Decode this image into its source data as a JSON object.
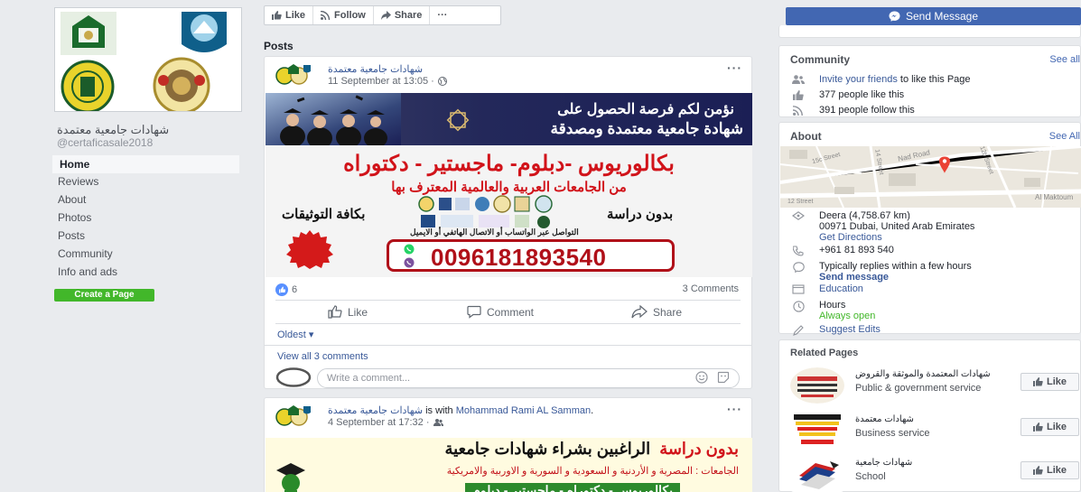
{
  "page": {
    "name": "شهادات جامعية معتمدة",
    "username": "@certaficasale2018"
  },
  "nav": {
    "items": [
      {
        "label": "Home",
        "active": true
      },
      {
        "label": "Reviews"
      },
      {
        "label": "About"
      },
      {
        "label": "Photos"
      },
      {
        "label": "Posts"
      },
      {
        "label": "Community"
      },
      {
        "label": "Info and ads"
      }
    ],
    "create_page": "Create a Page"
  },
  "action_bar": {
    "like": "Like",
    "follow": "Follow",
    "share": "Share",
    "more": "···"
  },
  "posts_heading": "Posts",
  "post1": {
    "author": "شهادات جامعية معتمدة",
    "date": "11 September at 13:05 ·",
    "menu": "···",
    "ad": {
      "line1": "نؤمن لكم فرصة الحصول على",
      "line2": "شهادة جامعية معتمدة ومصدقة",
      "degrees": "بكالوريوس -دبلوم- ماجستير - دكتوراه",
      "universities": "من الجامعات العربية والعالمية المعترف بها",
      "no_study": "بدون دراسة",
      "all_docs": "بكافة التوثيقات",
      "contact": "التواصل عبر الواتساب أو الاتصال الهاتفي أو الايميل",
      "phone": "0096181893540"
    },
    "reactions": "6",
    "comments_count": "3 Comments",
    "like": "Like",
    "comment": "Comment",
    "share": "Share",
    "sort": "Oldest ▾",
    "view_all": "View all 3 comments",
    "comment_placeholder": "Write a comment..."
  },
  "post2": {
    "author": "شهادات جامعية معتمدة",
    "with_text": " is with ",
    "with_name": "Mohammad Rami AL Samman",
    "with_end": ".",
    "date": "4 September at 17:32 ·",
    "menu": "···",
    "ad": {
      "line1_black": "الراغبين بشراء شهادات جامعية",
      "line1_red": "بدون دراسة",
      "line2": "الجامعات : المصرية و الأردنية و السعودية و السورية و الاوربية والامريكية",
      "line3": "بكالوريوس - دكتوراه - ماجستير - دبلوم"
    }
  },
  "right": {
    "send_message": "Send Message",
    "community": {
      "title": "Community",
      "see_all": "See all",
      "invite_link": "Invite your friends",
      "invite_rest": " to like this Page",
      "likes": "377 people like this",
      "follows": "391 people follow this"
    },
    "about": {
      "title": "About",
      "see_all": "See All",
      "address_line1": "Deera (4,758.67 km)",
      "address_line2": "00971 Dubai, United Arab Emirates",
      "directions": "Get Directions",
      "phone": "+961 81 893 540",
      "replies": "Typically replies within a few hours",
      "send_message": "Send message",
      "category": "Education",
      "hours": "Hours",
      "hours_status": "Always open",
      "suggest": "Suggest Edits",
      "map_labels": {
        "nad_road": "Nad Road",
        "street_12": "12 Street",
        "maktoum": "Al Maktoum",
        "st_15": "15c Street",
        "st_12b": "12b Street",
        "st_14": "14 Street"
      }
    },
    "related": {
      "title": "Related Pages",
      "items": [
        {
          "name": "شهادات المعتمدة والموثقة والقروض",
          "category": "Public & government service",
          "like": "Like"
        },
        {
          "name": "شهادات معتمدة",
          "category": "Business service",
          "like": "Like"
        },
        {
          "name": "شهادات جامعية",
          "category": "School",
          "like": "Like"
        }
      ]
    }
  },
  "colors": {
    "facebook_blue": "#4267b2",
    "link": "#385898",
    "green": "#42b72a",
    "ad_red": "#d1131a"
  }
}
